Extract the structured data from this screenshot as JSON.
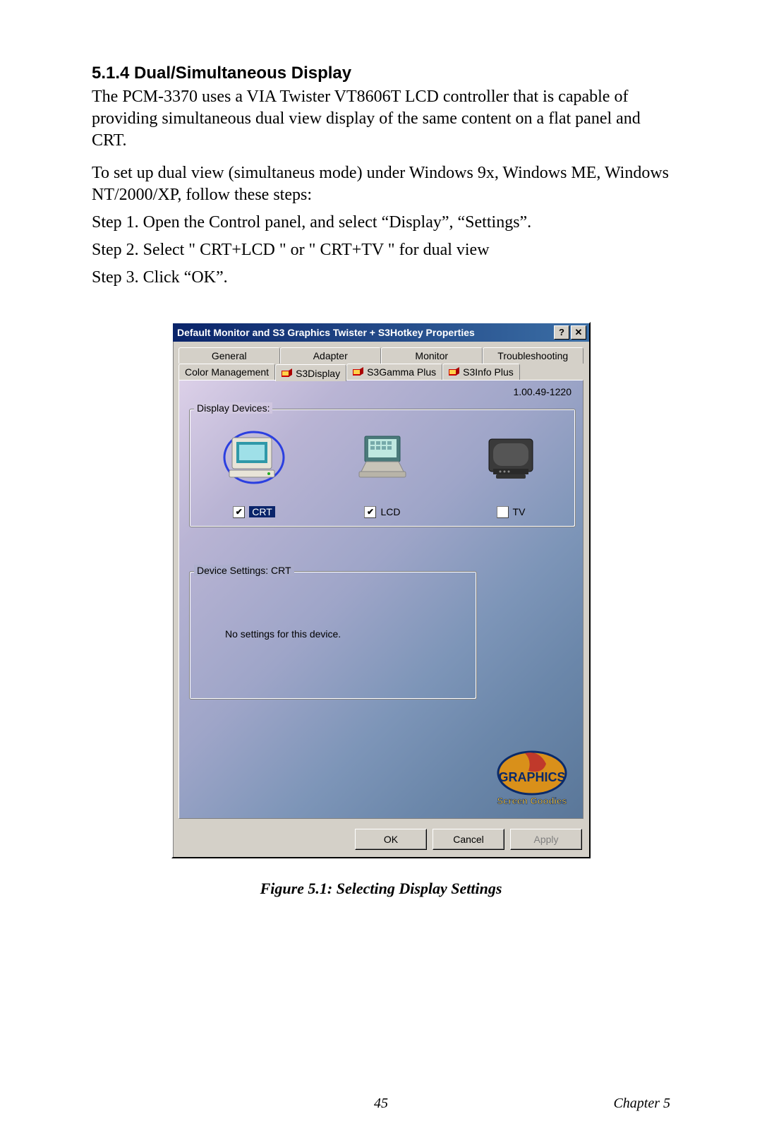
{
  "section_heading": "5.1.4 Dual/Simultaneous Display",
  "para1": "The PCM-3370 uses a VIA Twister VT8606T LCD controller that is capable of providing simultaneous dual view display of the same content on a flat panel and CRT.",
  "para2": "To set up dual view (simultaneus mode) under Windows 9x, Windows ME, Windows NT/2000/XP, follow these steps:",
  "step1": "Step 1.  Open the Control panel, and select “Display”, “Settings”.",
  "step2": "Step 2.  Select \" CRT+LCD \" or \" CRT+TV \" for dual view",
  "step3": "Step 3.  Click “OK”.",
  "dialog": {
    "title": "Default Monitor and S3 Graphics Twister + S3Hotkey Properties",
    "help_glyph": "?",
    "close_glyph": "✕",
    "tabs_row1": [
      "General",
      "Adapter",
      "Monitor",
      "Troubleshooting"
    ],
    "tabs_row2": [
      "Color Management",
      "S3Display",
      "S3Gamma Plus",
      "S3Info Plus"
    ],
    "active_tab": "S3Display",
    "version": "1.00.49-1220",
    "devices_label": "Display Devices:",
    "devices": [
      {
        "name": "CRT",
        "checked": true,
        "selected": true,
        "kind": "crt"
      },
      {
        "name": "LCD",
        "checked": true,
        "selected": false,
        "kind": "lcd"
      },
      {
        "name": "TV",
        "checked": false,
        "selected": false,
        "kind": "tv"
      }
    ],
    "settings_label": "Device Settings: CRT",
    "no_settings_text": "No settings for this device.",
    "logo_text_top": "GRAPHICS",
    "logo_text_bottom": "Screen Goodies",
    "buttons": {
      "ok": "OK",
      "cancel": "Cancel",
      "apply": "Apply"
    }
  },
  "figure_caption": "Figure 5.1: Selecting Display Settings",
  "footer": {
    "page": "45",
    "chapter": "Chapter 5"
  }
}
